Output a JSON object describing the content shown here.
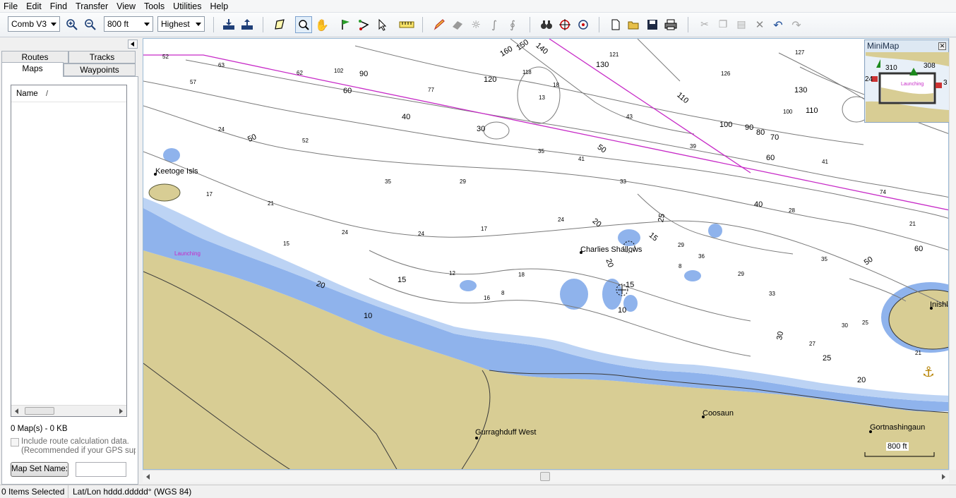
{
  "menubar": {
    "items": [
      "File",
      "Edit",
      "Find",
      "Transfer",
      "View",
      "Tools",
      "Utilities",
      "Help"
    ]
  },
  "toolbar": {
    "map_product": "Comb V3",
    "scale": "800 ft",
    "detail": "Highest"
  },
  "left_panel": {
    "tabs_row1": [
      "Routes",
      "Tracks"
    ],
    "tabs_row2": [
      "Maps",
      "Waypoints"
    ],
    "selected_tab": "Maps",
    "list_header_name": "Name",
    "list_header_sort": "/",
    "summary": "0 Map(s) - 0 KB",
    "include_route_label": "Include route calculation data.",
    "include_route_note": "(Recommended if your GPS suppo",
    "map_set_name_button": "Map Set Name:",
    "map_set_name_value": ""
  },
  "map": {
    "colors": {
      "land": "#d8cd94",
      "shallow": "#8fb3ec",
      "mid": "#bcd3f4",
      "water": "#ffffff",
      "contour": "#7a7a7a",
      "route": "#c72ac7"
    },
    "places": [
      "Keetoge Isls",
      "Charlies Shallows",
      "Gurraghduff West",
      "Coosaun",
      "Gortnashingaun",
      "Inishla",
      "Launching"
    ],
    "depth_labels": [
      "52",
      "63",
      "62",
      "102",
      "90",
      "60",
      "77",
      "118",
      "120",
      "150",
      "160",
      "140",
      "121",
      "130",
      "127",
      "126",
      "130",
      "110",
      "100",
      "110",
      "100",
      "90",
      "80",
      "70",
      "60",
      "57",
      "24",
      "50",
      "52",
      "40",
      "30",
      "13",
      "18",
      "35",
      "41",
      "43",
      "39",
      "50",
      "33",
      "29",
      "35",
      "21",
      "17",
      "15",
      "24",
      "24",
      "17",
      "24",
      "20",
      "25",
      "15",
      "20",
      "29",
      "8",
      "36",
      "35",
      "28",
      "41",
      "74",
      "40",
      "21",
      "60",
      "50",
      "12",
      "15",
      "18",
      "16",
      "8",
      "15",
      "10",
      "10",
      "20",
      "33",
      "29",
      "30",
      "27",
      "25",
      "30",
      "21",
      "25",
      "20",
      "10",
      "29",
      "50"
    ],
    "scale_bar": "800 ft"
  },
  "minimap": {
    "title": "MiniMap",
    "depths": [
      "310",
      "308",
      "24",
      "3"
    ],
    "launching": "Launching"
  },
  "status": {
    "selected": "0 Items Selected",
    "latlon": "Lat/Lon hddd.ddddd° (WGS 84)"
  }
}
